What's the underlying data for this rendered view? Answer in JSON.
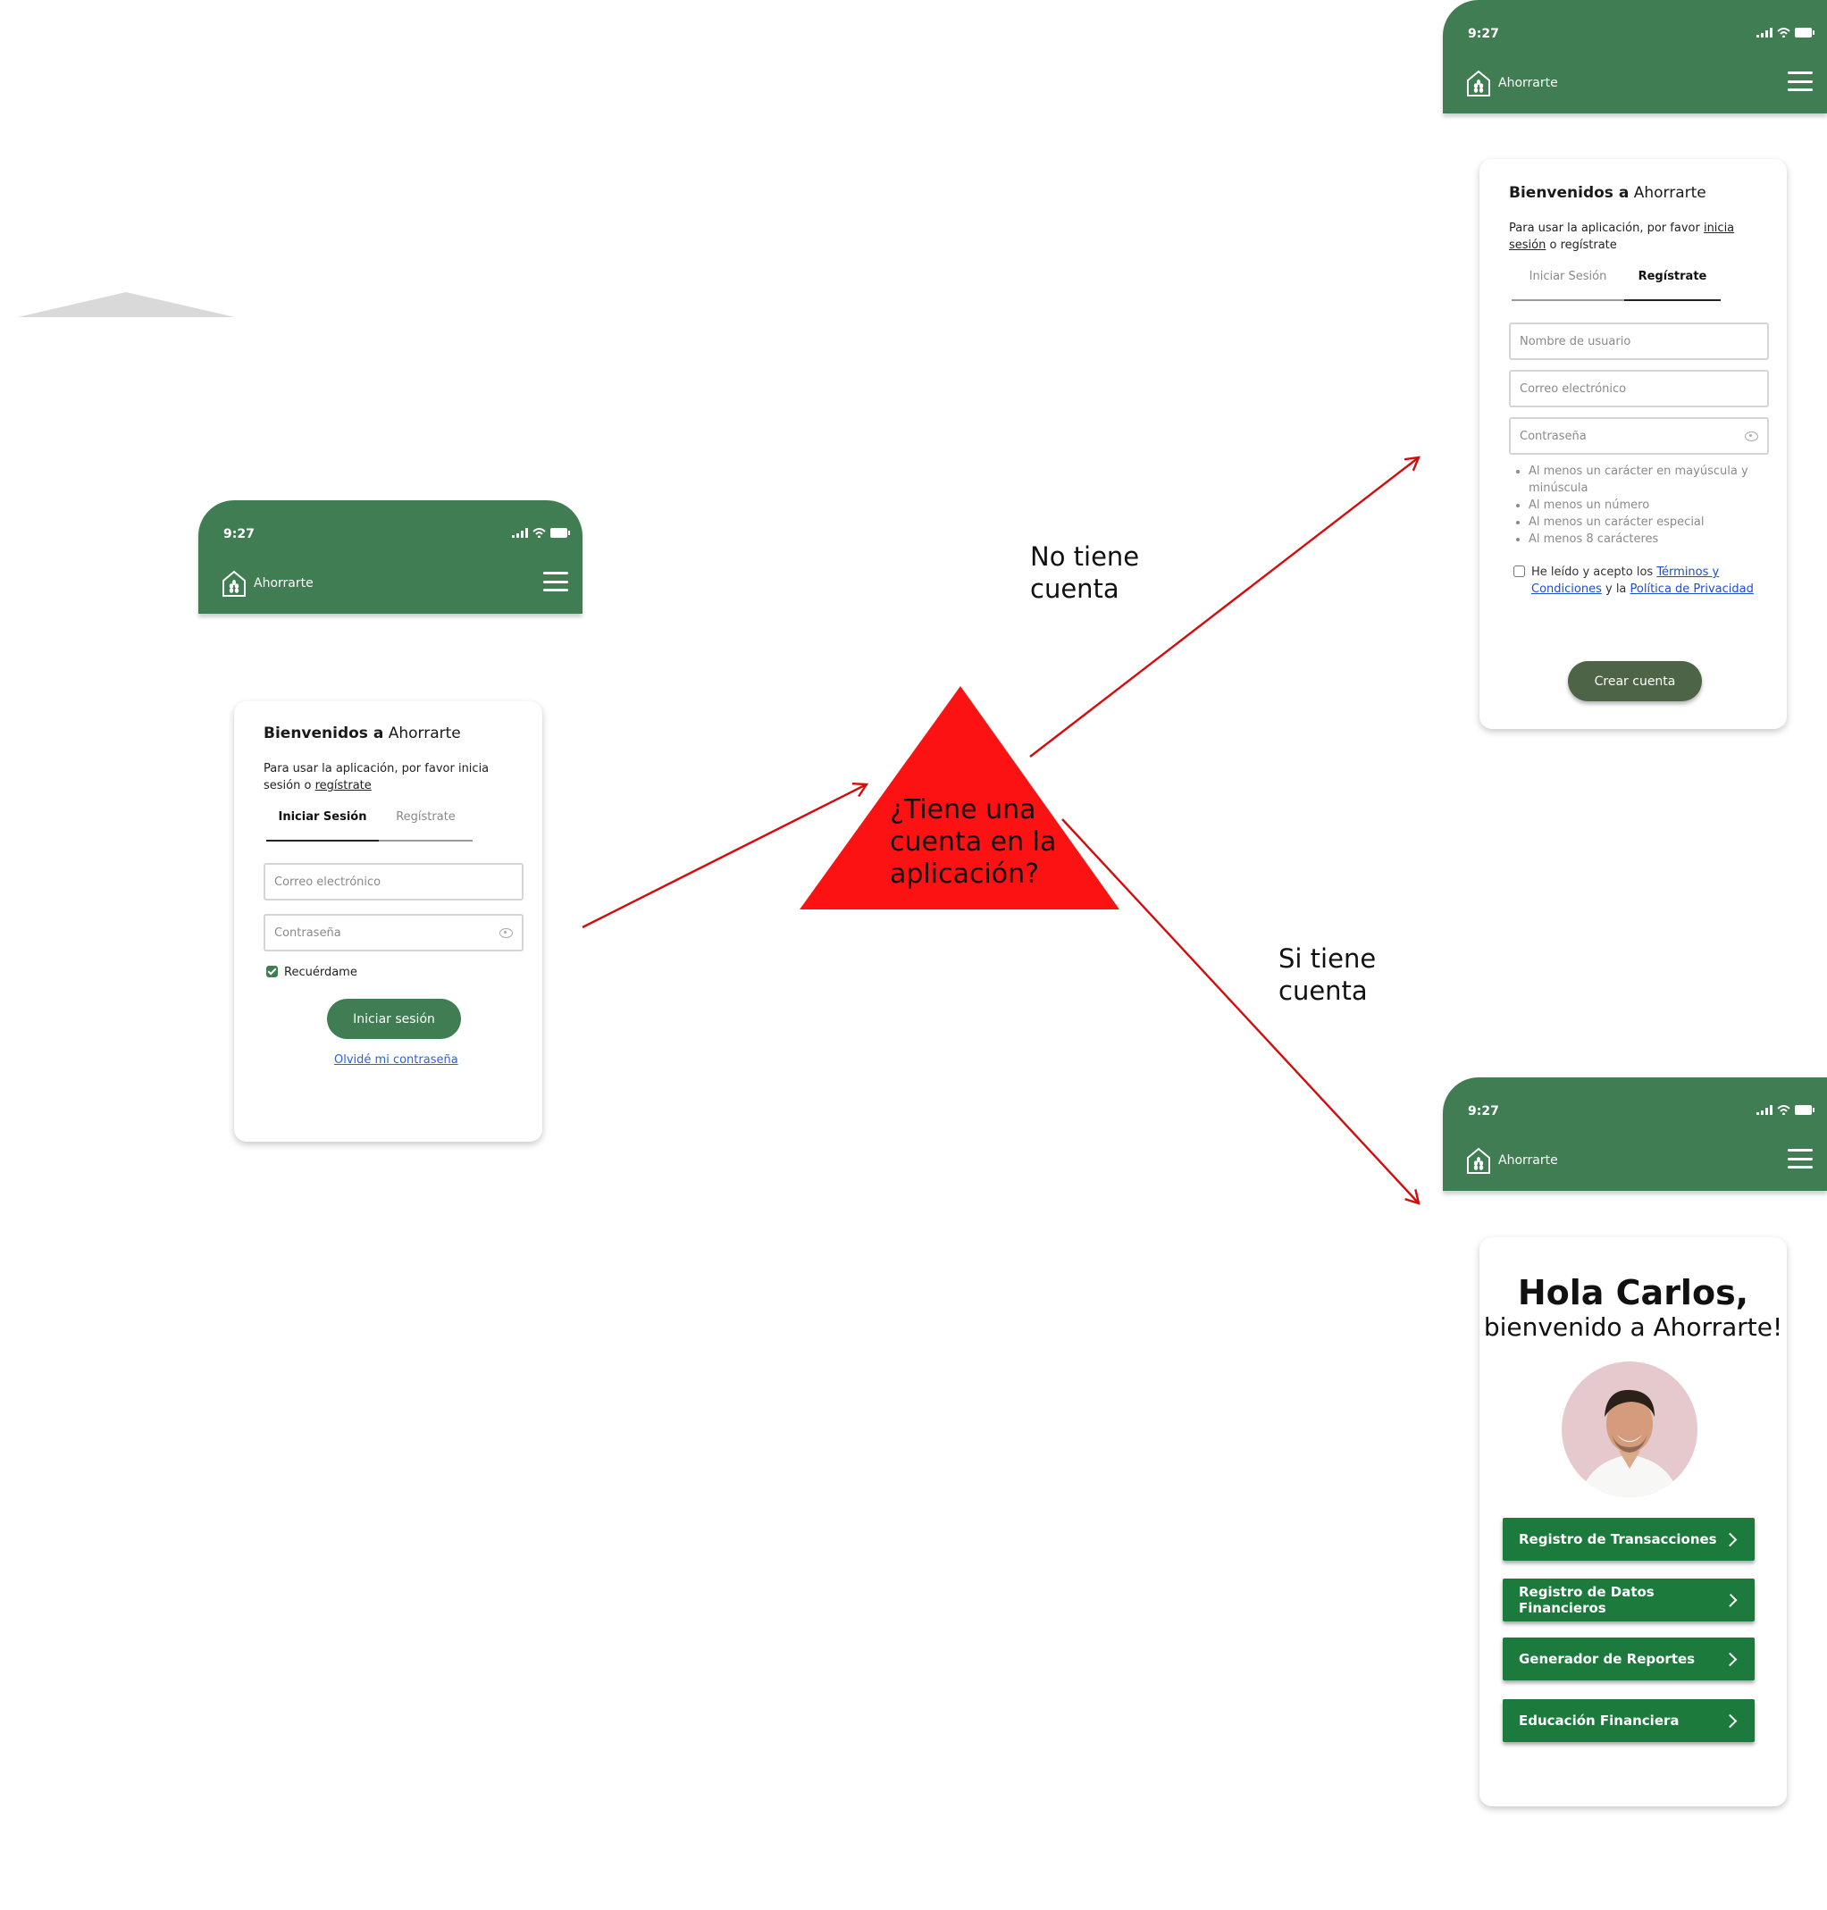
{
  "app": {
    "time": "9:27",
    "brand": "Ahorrarte",
    "welcome_bold": "Bienvenidos a",
    "welcome_rest": " Ahorrarte",
    "subtitle_before": "Para usar la aplicación, por favor ",
    "subtitle_link1": "inicia sesión",
    "subtitle_between": " o ",
    "subtitle_link2": "regístrate",
    "subtitle_start_left": "Para usar la aplicación, por favor inicia",
    "subtitle_line2_prefix": "sesión o ",
    "subtitle_line2_link": "regístrate",
    "subtitle_r_line1": "Para usar la aplicación, por favor ",
    "subtitle_r_link1a": "inicia",
    "subtitle_r_link1b": "sesión",
    "subtitle_r_line2_rest": " o regístrate"
  },
  "login": {
    "tab_login": "Iniciar Sesión",
    "tab_register": "Regístrate",
    "email_placeholder": "Correo electrónico",
    "password_placeholder": "Contraseña",
    "remember": "Recuérdame",
    "submit": "Iniciar sesión",
    "forgot": "Olvidé mi contraseña"
  },
  "register": {
    "tab_login": "Iniciar Sesión",
    "tab_register": "Regístrate",
    "username_placeholder": "Nombre de usuario",
    "email_placeholder": "Correo electrónico",
    "password_placeholder": "Contraseña",
    "rules": [
      "Al menos un carácter en mayúscula y minúscula",
      "Al menos un número",
      "Al menos un carácter especial",
      "Al menos 8 carácteres"
    ],
    "terms_prefix": "He leído y acepto los ",
    "terms_link": "Términos y Condiciones",
    "terms_mid": " y la ",
    "privacy_link": "Política de Privacidad",
    "submit": "Crear cuenta"
  },
  "home": {
    "greeting": "Hola Carlos,",
    "welcome": "bienvenido a Ahorrarte!",
    "menu": [
      "Registro de Transacciones",
      "Registro de Datos Financieros",
      "Generador de Reportes",
      "Educación Financiera"
    ]
  },
  "diagram": {
    "decision": "¿Tiene una cuenta en la aplicación?",
    "decision_lines": [
      "¿Tiene una",
      "cuenta en la",
      "aplicación?"
    ],
    "no_account": [
      "No tiene",
      "cuenta"
    ],
    "has_account": [
      "Si tiene",
      "cuenta"
    ]
  },
  "colors": {
    "brand_green": "#417d52",
    "button_green": "#1c7a3c",
    "dark_olive": "#4e6446",
    "arrow_red": "#d10d0d",
    "decision_red": "#fc1212",
    "link_blue": "#2b62d9"
  }
}
